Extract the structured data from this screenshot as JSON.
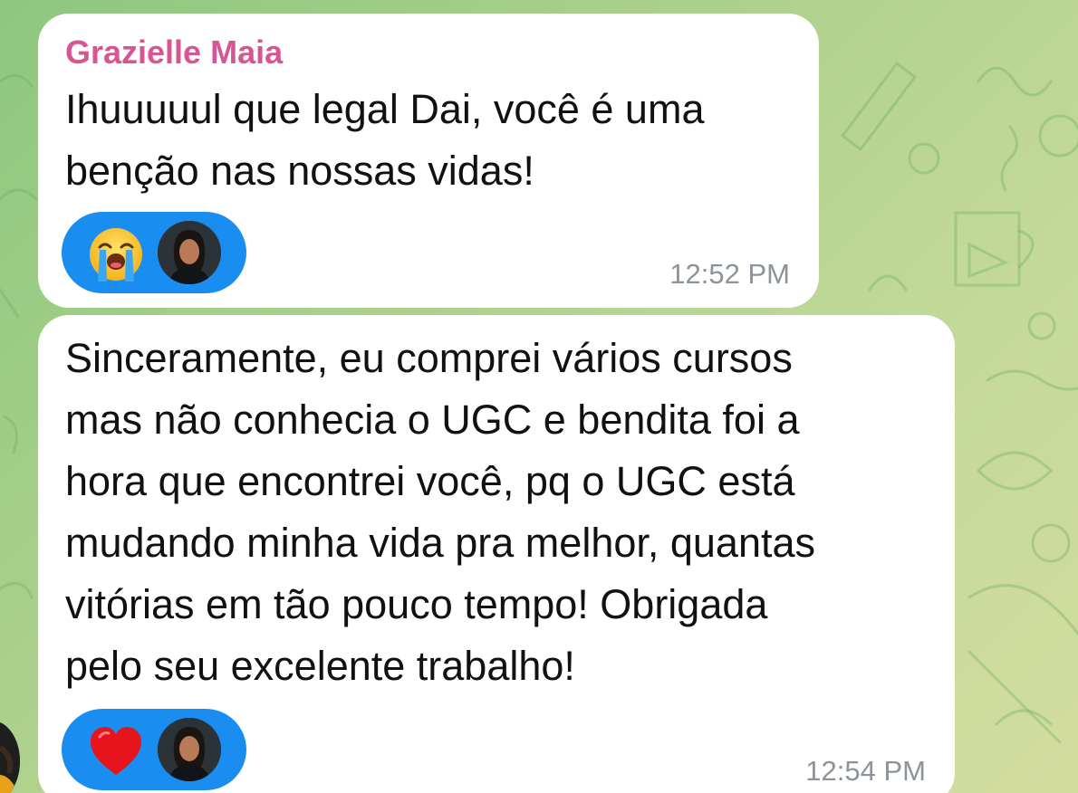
{
  "chat": {
    "messages": [
      {
        "sender": "Grazielle Maia",
        "text": "Ihuuuuul que legal Dai, você é uma\nbenção nas nossas vidas!",
        "time": "12:52 PM",
        "reaction_icon": "loudly-crying-face-emoji"
      },
      {
        "text": "Sinceramente, eu comprei vários cursos\nmas não conhecia o UGC e bendita foi a\nhora que encontrei você, pq o UGC está\nmudando minha vida pra melhor, quantas\nvitórias em tão pouco tempo! Obrigada\npelo seu excelente trabalho!",
        "time": "12:54 PM",
        "reaction_icon": "red-heart-emoji"
      }
    ]
  },
  "colors": {
    "sender_name": "#d65592",
    "reaction_pill": "#1a8ef0",
    "bubble": "#ffffff",
    "timestamp": "#8c9399"
  }
}
